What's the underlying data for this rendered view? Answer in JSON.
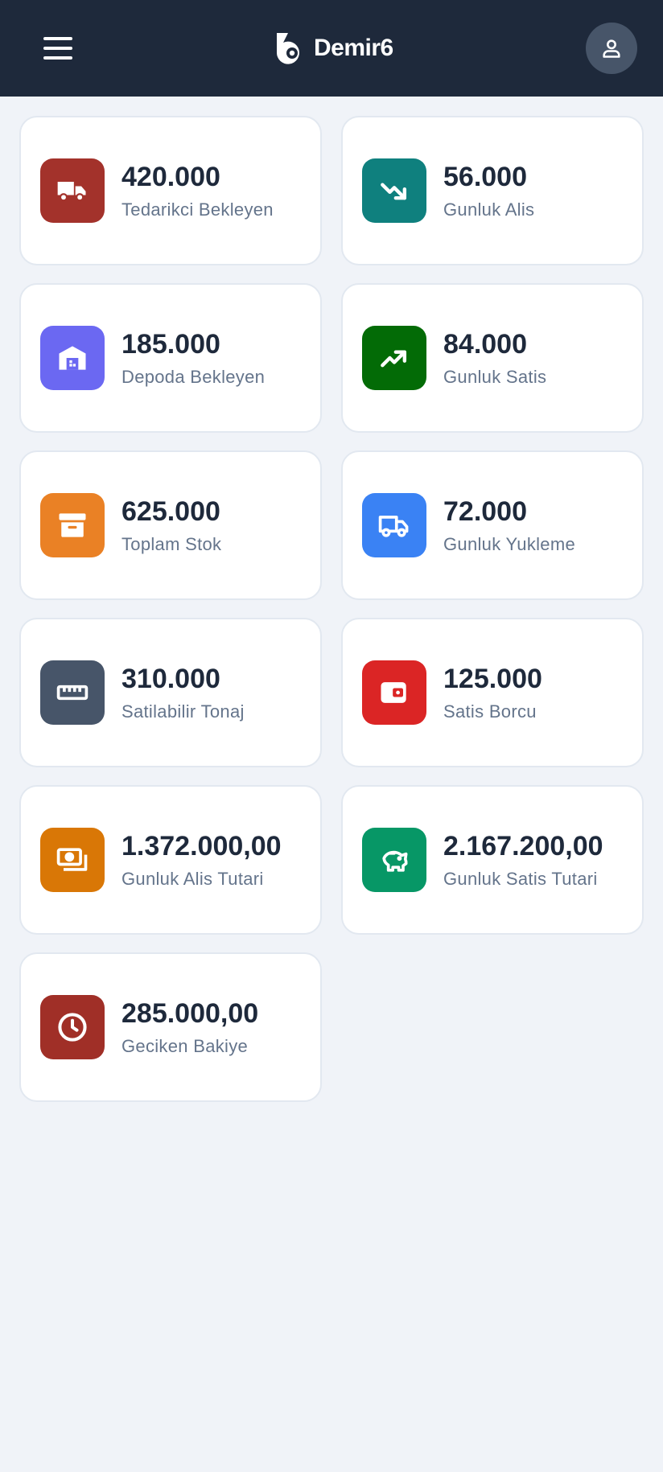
{
  "header": {
    "brand_name": "Demir6"
  },
  "cards": [
    {
      "value": "420.000",
      "label": "Tedarikci Bekleyen",
      "icon": "truck-icon",
      "color": "#a3322b"
    },
    {
      "value": "56.000",
      "label": "Gunluk Alis",
      "icon": "trending-down-icon",
      "color": "#0f807e"
    },
    {
      "value": "185.000",
      "label": "Depoda Bekleyen",
      "icon": "warehouse-icon",
      "color": "#6b68f2"
    },
    {
      "value": "84.000",
      "label": "Gunluk Satis",
      "icon": "trending-up-icon",
      "color": "#036b06"
    },
    {
      "value": "625.000",
      "label": "Toplam Stok",
      "icon": "archive-box-icon",
      "color": "#ea8125"
    },
    {
      "value": "72.000",
      "label": "Gunluk Yukleme",
      "icon": "delivery-truck-icon",
      "color": "#3a82f4"
    },
    {
      "value": "310.000",
      "label": "Satilabilir Tonaj",
      "icon": "ruler-icon",
      "color": "#475569"
    },
    {
      "value": "125.000",
      "label": "Satis Borcu",
      "icon": "wallet-icon",
      "color": "#db2525"
    },
    {
      "value": "1.372.000,00",
      "label": "Gunluk Alis Tutari",
      "icon": "banknotes-icon",
      "color": "#d97706"
    },
    {
      "value": "2.167.200,00",
      "label": "Gunluk Satis Tutari",
      "icon": "piggy-bank-icon",
      "color": "#079766"
    },
    {
      "value": "285.000,00",
      "label": "Geciken Bakiye",
      "icon": "clock-icon",
      "color": "#a02f27"
    }
  ]
}
